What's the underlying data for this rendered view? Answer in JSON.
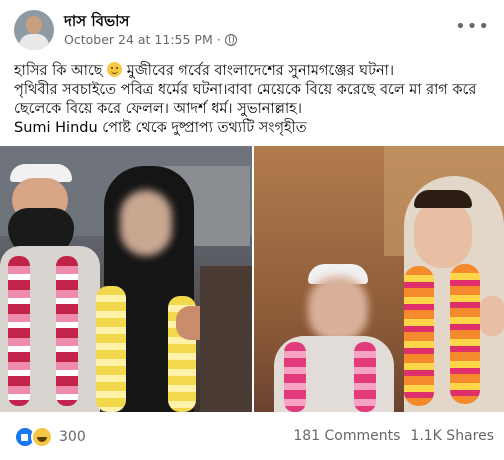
{
  "post": {
    "author": "দাস বিভাস",
    "timestamp": "October 24 at 11:55 PM",
    "separator": "·",
    "text_line1_a": "হাসির কি আছে ",
    "text_line1_b": " মুজীবের গর্বের বাংলাদেশের সুনামগঞ্জের ঘটনা।",
    "text_line2": "পৃথিবীর সবচাইতে পবিত্র ধর্মের ঘটনা।বাবা মেয়েকে বিয়ে করেছে বলে মা রাগ করে ছেলেকে বিয়ে করে ফেলল। আদর্শ ধর্ম। সুভানাল্লাহ।",
    "text_line3": "Sumi Hindu পোষ্ট থেকে দুষ্প্রাপ্য তথ্যটি সংগৃহীত"
  },
  "footer": {
    "reaction_count": "300",
    "comments": "181 Comments",
    "shares": "1.1K Shares"
  },
  "icons": {
    "globe": "globe-icon",
    "more": "more-options-icon",
    "like": "like-reaction-icon",
    "haha": "haha-reaction-icon"
  },
  "colors": {
    "fb_blue": "#1877f2",
    "meta_gray": "#65676b"
  }
}
